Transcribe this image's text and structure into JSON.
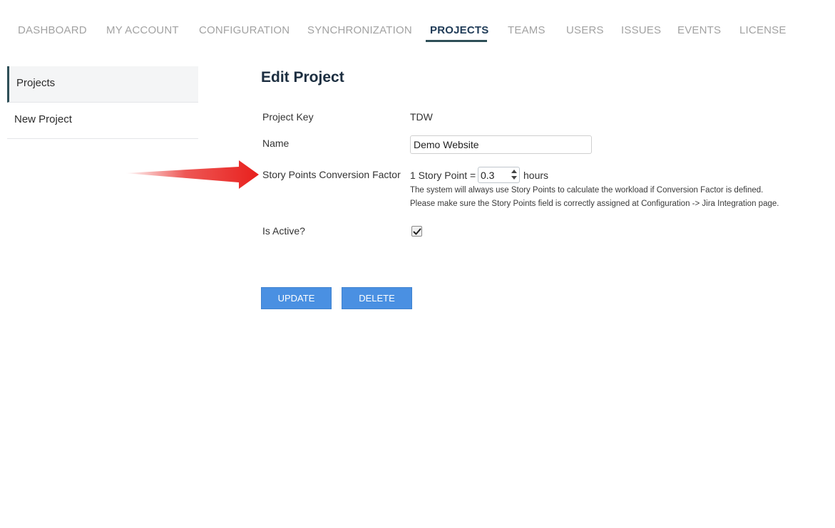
{
  "nav": {
    "items": [
      {
        "label": "DASHBOARD"
      },
      {
        "label": "MY ACCOUNT"
      },
      {
        "label": "CONFIGURATION"
      },
      {
        "label": "SYNCHRONIZATION"
      },
      {
        "label": "PROJECTS"
      },
      {
        "label": "TEAMS"
      },
      {
        "label": "USERS"
      },
      {
        "label": "ISSUES"
      },
      {
        "label": "EVENTS"
      },
      {
        "label": "LICENSE"
      }
    ],
    "active": "PROJECTS"
  },
  "sidebar": {
    "items": [
      {
        "label": "Projects"
      },
      {
        "label": "New Project"
      }
    ]
  },
  "form": {
    "title": "Edit Project",
    "project_key_label": "Project Key",
    "project_key_value": "TDW",
    "name_label": "Name",
    "name_value": "Demo Website",
    "sp_label": "Story Points Conversion Factor",
    "sp_prefix": "1 Story Point =",
    "sp_value": "0.3",
    "sp_suffix": "hours",
    "hint_line1": "The system will always use Story Points to calculate the workload if Conversion Factor is defined.",
    "hint_line2": "Please make sure the Story Points field is correctly assigned at Configuration -> Jira Integration page.",
    "active_label": "Is Active?",
    "active_checked": true
  },
  "buttons": {
    "update": "UPDATE",
    "delete": "DELETE"
  },
  "colors": {
    "accent": "#4a90e2",
    "nav_active": "#1f3b57",
    "nav_inactive": "#a2a2a2",
    "arrow": "#e8201d"
  }
}
